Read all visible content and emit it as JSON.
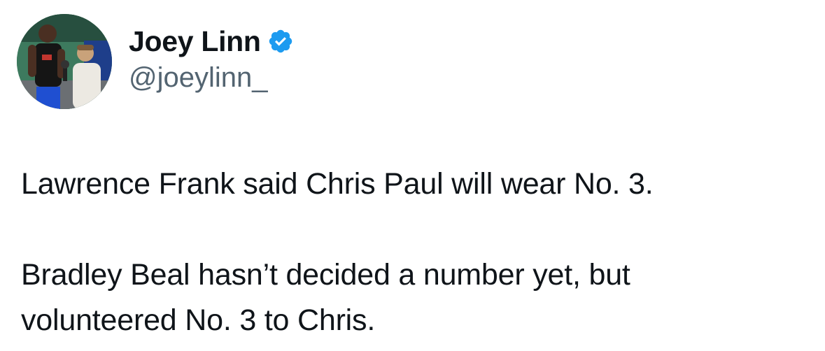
{
  "author": {
    "display_name": "Joey Linn",
    "handle": "@joeylinn_",
    "verified": true,
    "verified_color": "#1d9bf0"
  },
  "icons": {
    "avatar": "profile-photo",
    "verified": "verified-badge-icon"
  },
  "tweet": {
    "paragraphs": [
      "Lawrence Frank said Chris Paul will wear No. 3.",
      "Bradley Beal hasn’t decided a number yet, but\nvolunteered No. 3 to Chris."
    ]
  },
  "colors": {
    "text_primary": "#0f1419",
    "text_secondary": "#536471",
    "background": "#ffffff"
  }
}
